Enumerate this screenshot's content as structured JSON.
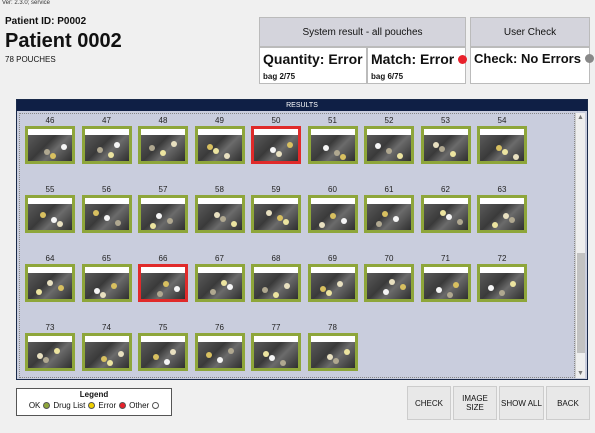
{
  "app": {
    "version": "Ver: 2.3.0; service"
  },
  "patient": {
    "id_label": "Patient ID: P0002",
    "name": "Patient 0002",
    "pouches": "78 POUCHES"
  },
  "system_result": {
    "header": "System result - all pouches",
    "quantity": {
      "text": "Quantity: Error",
      "status_color": "#e8202a",
      "bag": "bag 2/75"
    },
    "match": {
      "text": "Match: Error",
      "status_color": "#e8202a",
      "bag": "bag 6/75"
    }
  },
  "user_check": {
    "header": "User Check",
    "text": "Check: No Errors",
    "status_color": "#888888"
  },
  "results": {
    "title": "RESULTS",
    "rows": [
      [
        {
          "num": "46",
          "status": "ok"
        },
        {
          "num": "47",
          "status": "ok"
        },
        {
          "num": "48",
          "status": "ok"
        },
        {
          "num": "49",
          "status": "ok"
        },
        {
          "num": "50",
          "status": "error"
        },
        {
          "num": "51",
          "status": "ok"
        },
        {
          "num": "52",
          "status": "ok"
        },
        {
          "num": "53",
          "status": "ok"
        },
        {
          "num": "54",
          "status": "ok"
        }
      ],
      [
        {
          "num": "55",
          "status": "ok"
        },
        {
          "num": "56",
          "status": "ok"
        },
        {
          "num": "57",
          "status": "ok"
        },
        {
          "num": "58",
          "status": "ok"
        },
        {
          "num": "59",
          "status": "ok"
        },
        {
          "num": "60",
          "status": "ok"
        },
        {
          "num": "61",
          "status": "ok"
        },
        {
          "num": "62",
          "status": "ok"
        },
        {
          "num": "63",
          "status": "ok"
        }
      ],
      [
        {
          "num": "64",
          "status": "ok"
        },
        {
          "num": "65",
          "status": "ok"
        },
        {
          "num": "66",
          "status": "error"
        },
        {
          "num": "67",
          "status": "ok"
        },
        {
          "num": "68",
          "status": "ok"
        },
        {
          "num": "69",
          "status": "ok"
        },
        {
          "num": "70",
          "status": "ok"
        },
        {
          "num": "71",
          "status": "ok"
        },
        {
          "num": "72",
          "status": "ok"
        }
      ],
      [
        {
          "num": "73",
          "status": "ok"
        },
        {
          "num": "74",
          "status": "ok"
        },
        {
          "num": "75",
          "status": "ok"
        },
        {
          "num": "76",
          "status": "ok"
        },
        {
          "num": "77",
          "status": "ok"
        },
        {
          "num": "78",
          "status": "ok"
        }
      ]
    ]
  },
  "legend": {
    "title": "Legend",
    "items": [
      {
        "label": "OK",
        "color": "#8ea63a"
      },
      {
        "label": "Drug List",
        "color": "#f0d000"
      },
      {
        "label": "Error",
        "color": "#e8202a"
      },
      {
        "label": "Other",
        "color": "#ffffff"
      }
    ]
  },
  "buttons": {
    "check": "CHECK",
    "image_size": "IMAGE SIZE",
    "show_all": "SHOW ALL",
    "back": "BACK"
  }
}
